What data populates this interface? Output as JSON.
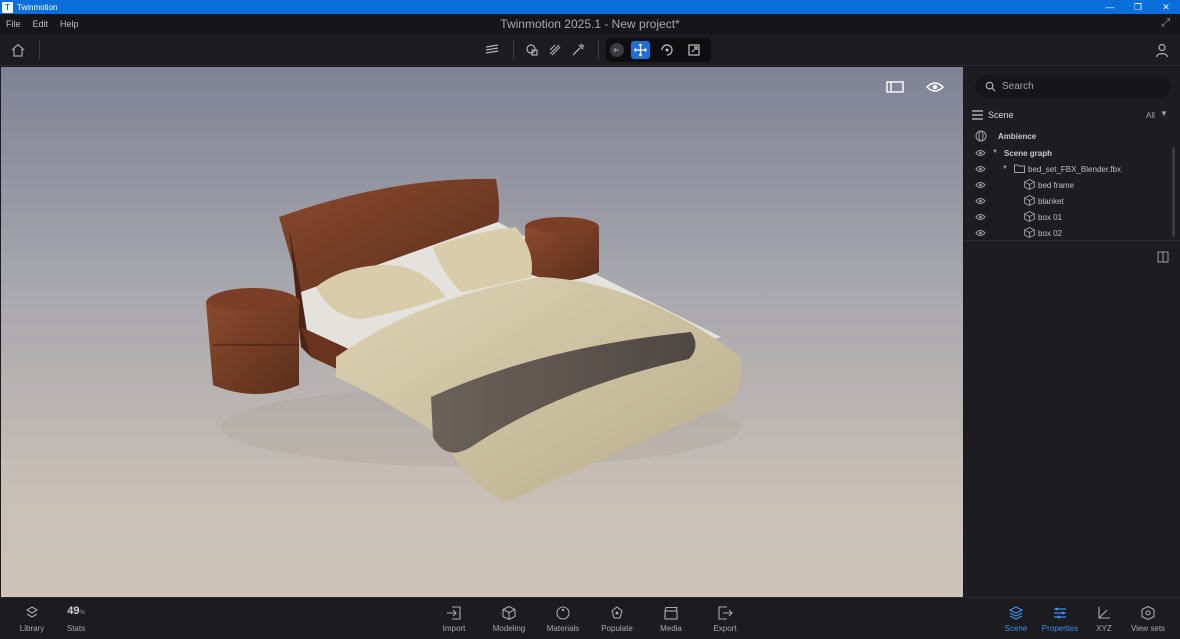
{
  "window": {
    "app_name": "Twinmotion",
    "logo_letter": "T",
    "title": "Twinmotion 2025.1 - New project*",
    "controls": [
      "—",
      "❐",
      "✕"
    ]
  },
  "menu": {
    "items": [
      "File",
      "Edit",
      "Help"
    ]
  },
  "toolbar": {
    "icons": [
      "home-icon",
      "layers-icon",
      "shapes-icon",
      "paint-icon",
      "eyedropper-icon",
      "back-icon",
      "move-icon",
      "rotate-icon",
      "scale-icon",
      "user-icon"
    ],
    "active_tool": "move"
  },
  "viewport": {
    "buttons": [
      "panel-toggle-icon",
      "eye-icon"
    ],
    "accent": "#1e6fd6"
  },
  "panel": {
    "search_placeholder": "Search",
    "scene_label": "Scene",
    "filter_label": "All",
    "ambience_label": "Ambience",
    "tree": [
      {
        "label": "Scene graph",
        "kind": "group"
      },
      {
        "label": "bed_set_FBX_Blender.fbx",
        "kind": "folder"
      },
      {
        "label": "bed frame",
        "kind": "object"
      },
      {
        "label": "blanket",
        "kind": "object"
      },
      {
        "label": "box 01",
        "kind": "object"
      },
      {
        "label": "box 02",
        "kind": "object"
      }
    ]
  },
  "bottom": {
    "library_label": "Library",
    "stats_value": "49",
    "stats_unit": "%",
    "stats_label": "Stats",
    "center": [
      "Import",
      "Modeling",
      "Materials",
      "Populate",
      "Media",
      "Export"
    ],
    "right": [
      "Scene",
      "Properties",
      "XYZ",
      "View sets"
    ],
    "active": [
      "Scene",
      "Properties"
    ],
    "active_color": "#3b8ef0"
  }
}
